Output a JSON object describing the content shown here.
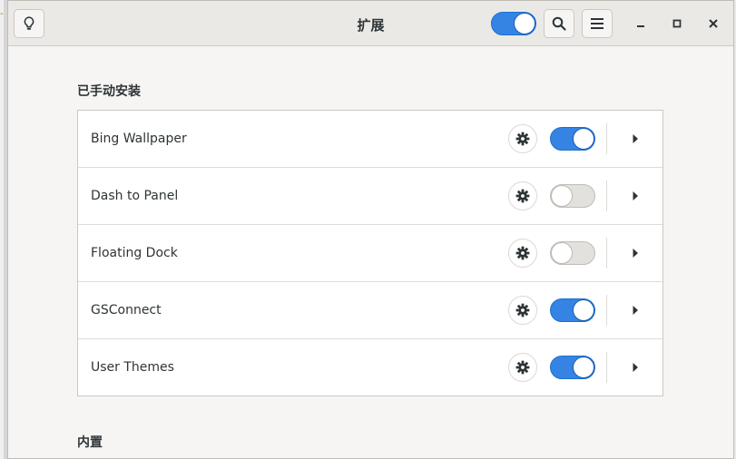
{
  "window": {
    "title": "扩展"
  },
  "header": {
    "master_switch_on": true,
    "buttons": {
      "tips": "lightbulb-icon",
      "search": "search-icon",
      "menu": "hamburger-menu-icon",
      "minimize": "minimize-icon",
      "maximize": "maximize-icon",
      "close": "close-icon"
    }
  },
  "sections": {
    "manual": {
      "title": "已手动安装",
      "items": [
        {
          "name": "Bing Wallpaper",
          "enabled": true
        },
        {
          "name": "Dash to Panel",
          "enabled": false
        },
        {
          "name": "Floating Dock",
          "enabled": false
        },
        {
          "name": "GSConnect",
          "enabled": true
        },
        {
          "name": "User Themes",
          "enabled": true
        }
      ]
    },
    "builtin": {
      "title": "内置"
    }
  },
  "colors": {
    "accent": "#3584e4",
    "window_bg": "#f6f5f4",
    "header_bg": "#ebe9e6"
  }
}
